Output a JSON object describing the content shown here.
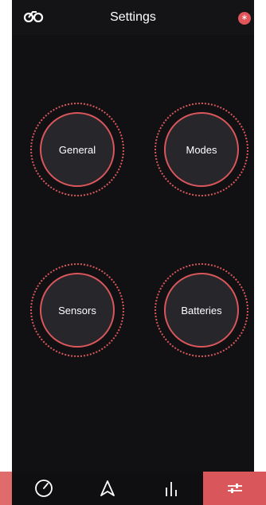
{
  "header": {
    "title": "Settings",
    "logo_icon": "bike-logo-icon",
    "status_icon": "bluetooth-icon",
    "status_glyph": "∗"
  },
  "menu": {
    "items": [
      {
        "label": "General"
      },
      {
        "label": "Modes"
      },
      {
        "label": "Sensors"
      },
      {
        "label": "Batteries"
      }
    ]
  },
  "bottom_nav": {
    "items": [
      {
        "icon": "speedometer-icon",
        "active": false
      },
      {
        "icon": "navigation-icon",
        "active": false
      },
      {
        "icon": "stats-icon",
        "active": false
      },
      {
        "icon": "sliders-icon",
        "active": true
      }
    ]
  },
  "colors": {
    "accent": "#d9575b",
    "background": "#16161a",
    "dial_fill": "#26262b"
  }
}
